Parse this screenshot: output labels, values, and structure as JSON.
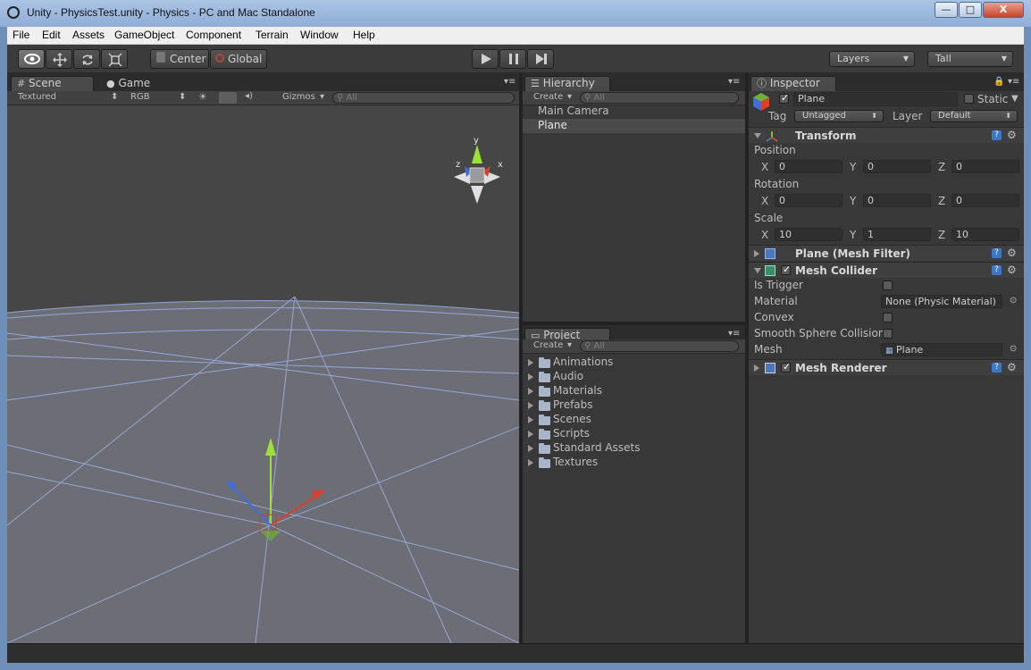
{
  "window": {
    "title": "Unity - PhysicsTest.unity - Physics - PC and Mac Standalone",
    "close": "X",
    "min": "—",
    "max": "□"
  },
  "menu": [
    "File",
    "Edit",
    "Assets",
    "GameObject",
    "Component",
    "Terrain",
    "Window",
    "Help"
  ],
  "toolbar": {
    "center_label": "Center",
    "global_label": "Global",
    "layers_label": "Layers",
    "layout_label": "Tall"
  },
  "scene": {
    "tabs": {
      "scene": "Scene",
      "game": "Game"
    },
    "render_mode": "Textured",
    "color_mode": "RGB",
    "gizmos_label": "Gizmos",
    "search_placeholder": "All",
    "gizmo_labels": {
      "x": "x",
      "y": "y",
      "z": "z"
    }
  },
  "hierarchy": {
    "tab": "Hierarchy",
    "create_label": "Create",
    "search_placeholder": "All",
    "items": [
      "Main Camera",
      "Plane"
    ],
    "selected": "Plane"
  },
  "project": {
    "tab": "Project",
    "create_label": "Create",
    "search_placeholder": "All",
    "folders": [
      "Animations",
      "Audio",
      "Materials",
      "Prefabs",
      "Scenes",
      "Scripts",
      "Standard Assets",
      "Textures"
    ]
  },
  "inspector": {
    "tab": "Inspector",
    "object_name": "Plane",
    "static_label": "Static",
    "tag_label": "Tag",
    "tag_value": "Untagged",
    "layer_label": "Layer",
    "layer_value": "Default",
    "transform": {
      "title": "Transform",
      "position_label": "Position",
      "rotation_label": "Rotation",
      "scale_label": "Scale",
      "axis": {
        "x": "X",
        "y": "Y",
        "z": "Z"
      },
      "position": {
        "x": "0",
        "y": "0",
        "z": "0"
      },
      "rotation": {
        "x": "0",
        "y": "0",
        "z": "0"
      },
      "scale": {
        "x": "10",
        "y": "1",
        "z": "10"
      }
    },
    "mesh_filter": {
      "title": "Plane (Mesh Filter)"
    },
    "mesh_collider": {
      "title": "Mesh Collider",
      "is_trigger_label": "Is Trigger",
      "material_label": "Material",
      "material_value": "None (Physic Material)",
      "convex_label": "Convex",
      "smooth_label": "Smooth Sphere Collision",
      "mesh_label": "Mesh",
      "mesh_value": "Plane"
    },
    "mesh_renderer": {
      "title": "Mesh Renderer"
    }
  },
  "colors": {
    "editor_bg": "#383838",
    "selected_row": "#4a4a4a",
    "grid": "#9ab3e8",
    "plane": "#6d6e75",
    "sky": "#464646",
    "accent_blue": "#3c78c9"
  }
}
